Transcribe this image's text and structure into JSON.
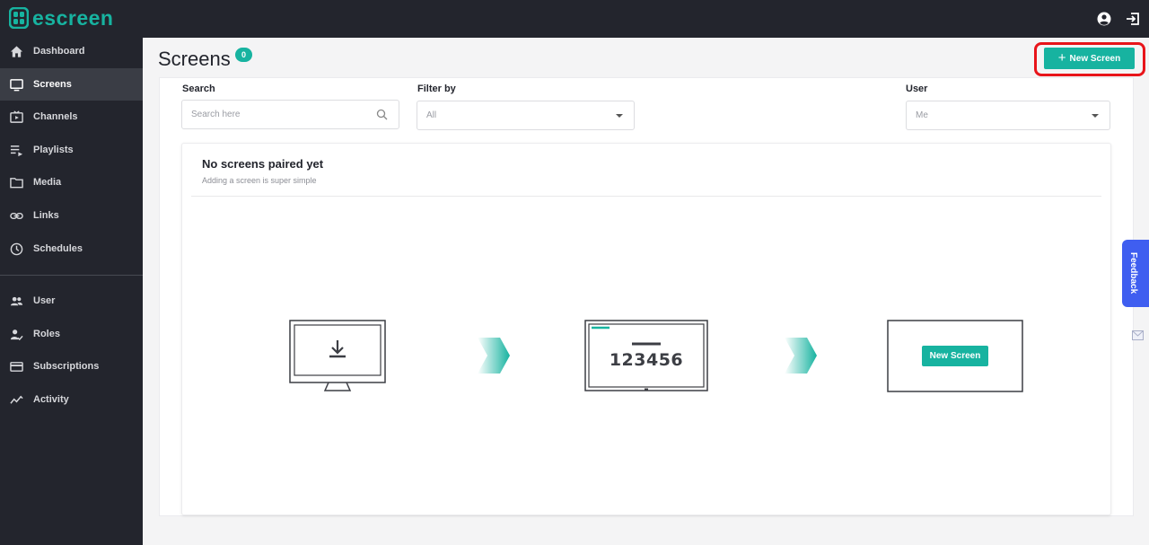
{
  "app": {
    "brand": "escreen",
    "accent_color": "#17b3a0",
    "alert_color": "#e8141a",
    "feedback_color": "#3f5ef0"
  },
  "topbar": {
    "icons": [
      "user-circle-icon",
      "logout-icon"
    ]
  },
  "sidebar": {
    "items": [
      {
        "label": "Dashboard",
        "icon": "home-icon",
        "active": false
      },
      {
        "label": "Screens",
        "icon": "monitor-icon",
        "active": true
      },
      {
        "label": "Channels",
        "icon": "channel-icon",
        "active": false
      },
      {
        "label": "Playlists",
        "icon": "playlist-icon",
        "active": false
      },
      {
        "label": "Media",
        "icon": "folder-icon",
        "active": false
      },
      {
        "label": "Links",
        "icon": "link-icon",
        "active": false
      },
      {
        "label": "Schedules",
        "icon": "clock-icon",
        "active": false
      },
      {
        "label": "User",
        "icon": "users-icon",
        "active": false
      },
      {
        "label": "Roles",
        "icon": "user-check-icon",
        "active": false
      },
      {
        "label": "Subscriptions",
        "icon": "card-icon",
        "active": false
      },
      {
        "label": "Activity",
        "icon": "activity-icon",
        "active": false
      }
    ]
  },
  "header": {
    "title": "Screens",
    "count": "0",
    "new_button_label": "New Screen"
  },
  "filters": {
    "search_label": "Search",
    "search_placeholder": "Search here",
    "filter_label": "Filter by",
    "filter_value": "All",
    "user_label": "User",
    "user_value": "Me"
  },
  "empty_state": {
    "title": "No screens paired yet",
    "subtitle": "Adding a screen is super simple",
    "pairing_code": "123456",
    "step_button_label": "New Screen"
  },
  "feedback": {
    "label": "Feedback"
  }
}
